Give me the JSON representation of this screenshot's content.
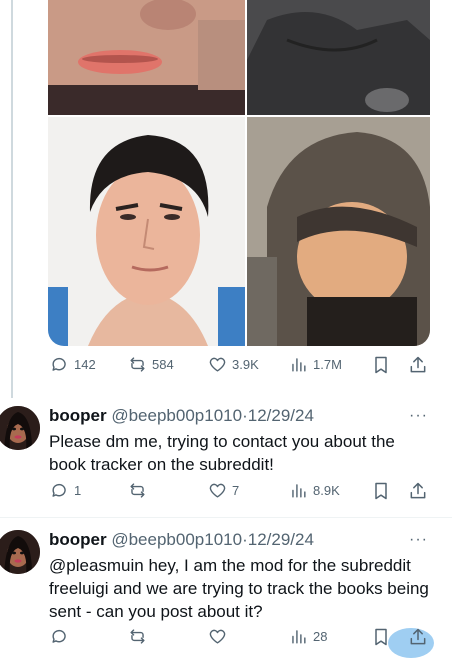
{
  "tweet": {
    "stats": {
      "replies": "142",
      "reposts": "584",
      "likes": "3.9K",
      "views": "1.7M"
    }
  },
  "replies": [
    {
      "name": "booper",
      "handle": "@beepb00p1010",
      "separator": "·",
      "date": "12/29/24",
      "text": "Please dm me, trying to contact you about the book tracker on the subreddit!",
      "stats": {
        "replies": "1",
        "reposts": "",
        "likes": "7",
        "views": "8.9K"
      }
    },
    {
      "name": "booper",
      "handle": "@beepb00p1010",
      "separator": "·",
      "date": "12/29/24",
      "text": "@pleasmuin hey, I am the mod for the subreddit freeluigi and we are trying to track the books being sent - can you post about it?",
      "stats": {
        "replies": "",
        "reposts": "",
        "likes": "",
        "views": "28"
      }
    }
  ],
  "icons": [
    "reply-icon",
    "repost-icon",
    "like-icon",
    "views-icon",
    "bookmark-icon",
    "share-icon",
    "more-icon"
  ],
  "colors": {
    "secondary_text": "#536471",
    "primary_text": "#0f1419",
    "divider": "#eff3f4",
    "thread_line": "#cfd9de"
  }
}
